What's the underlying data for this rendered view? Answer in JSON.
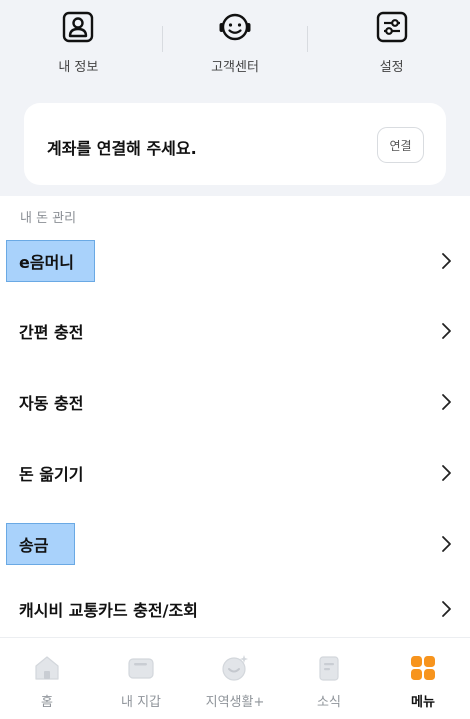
{
  "quick_menu": {
    "items": [
      {
        "label": "내 정보",
        "icon": "profile-icon"
      },
      {
        "label": "고객센터",
        "icon": "headset-icon"
      },
      {
        "label": "설정",
        "icon": "settings-sliders-icon"
      }
    ]
  },
  "account_card": {
    "text": "계좌를 연결해 주세요.",
    "button_label": "연결"
  },
  "money_section": {
    "title": "내 돈 관리",
    "items": [
      {
        "label": "e음머니",
        "highlighted": true
      },
      {
        "label": "간편 충전",
        "highlighted": false
      },
      {
        "label": "자동 충전",
        "highlighted": false
      },
      {
        "label": "돈 옮기기",
        "highlighted": false
      },
      {
        "label": "송금",
        "highlighted": true
      },
      {
        "label": "캐시비 교통카드 충전/조회",
        "highlighted": false
      }
    ]
  },
  "bottom_nav": {
    "items": [
      {
        "label": "홈",
        "icon": "home-icon",
        "active": false
      },
      {
        "label": "내 지갑",
        "icon": "wallet-icon",
        "active": false
      },
      {
        "label": "지역생활+",
        "icon": "local-life-icon",
        "active": false
      },
      {
        "label": "소식",
        "icon": "news-icon",
        "active": false
      },
      {
        "label": "메뉴",
        "icon": "menu-grid-icon",
        "active": true
      }
    ]
  },
  "colors": {
    "accent": "#f7941d",
    "highlight": "#a9d2fb",
    "top_background": "#f1f3f7"
  }
}
